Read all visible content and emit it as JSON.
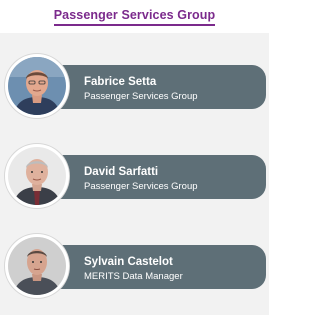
{
  "header": {
    "title": "Passenger Services Group"
  },
  "people": [
    {
      "name": "Fabrice Setta",
      "role": "Passenger Services Group"
    },
    {
      "name": "David Sarfatti",
      "role": "Passenger Services Group"
    },
    {
      "name": "Sylvain Castelot",
      "role": "MERITS Data Manager"
    }
  ]
}
